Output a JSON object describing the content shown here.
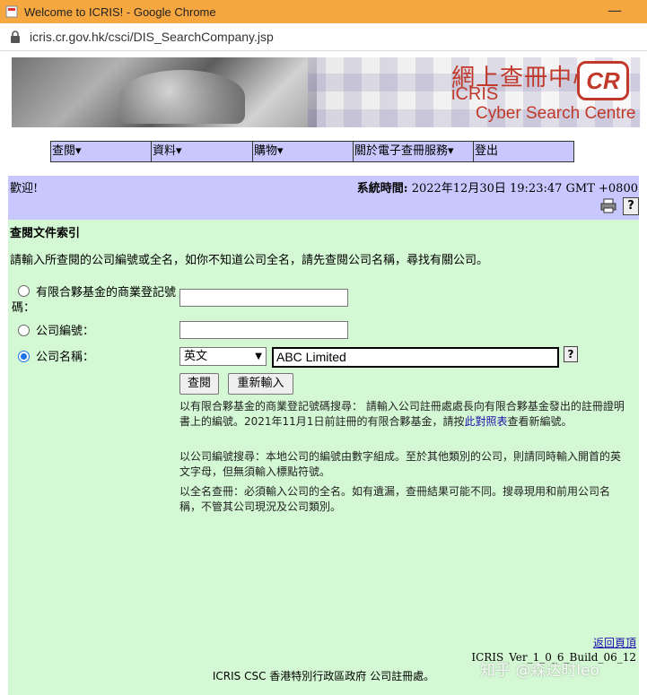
{
  "window": {
    "title": "Welcome to ICRIS! - Google Chrome",
    "minimize": "—"
  },
  "address": {
    "url": "icris.cr.gov.hk/csci/DIS_SearchCompany.jsp"
  },
  "banner": {
    "title_cjk": "網上查冊中心",
    "logo": "CR",
    "brand": "iCRIS",
    "subtitle": "Cyber Search Centre"
  },
  "menu": [
    {
      "label": "查閱▾"
    },
    {
      "label": "資料▾"
    },
    {
      "label": "購物▾"
    },
    {
      "label": "關於電子查冊服務▾"
    },
    {
      "label": "登出"
    }
  ],
  "welcome": {
    "greeting": "歡迎!",
    "time_label": "系統時間:",
    "time_value": " 2022年12月30日 19:23:47 GMT +0800",
    "help_glyph": "?"
  },
  "form": {
    "heading": "查閱文件索引",
    "instruction": "請輸入所查閱的公司編號或全名，如你不知道公司全名，請先查閱公司名稱，尋找有關公司。",
    "option_brn_label": "有限合夥基金的商業登記號碼：",
    "option_crno_label": "公司編號：",
    "option_name_label": "公司名稱：",
    "language_select": "英文",
    "company_name_value": "ABC Limited",
    "search_button": "查閱",
    "reset_button": "重新輸入",
    "help_glyph": "?",
    "note1_a": "以有限合夥基金的商業登記號碼搜尋： 請輸入公司註冊處處長向有限合夥基金發出的註冊證明書上的編號。2021年11月1日前註冊的有限合夥基金，請按",
    "note1_link": "此對照表",
    "note1_b": "查看新編號。",
    "note2": "以公司編號搜尋：本地公司的編號由數字組成。至於其他類別的公司，則請同時輸入開首的英文字母，但無須輸入標點符號。",
    "note3": "以全名查冊：必須輸入公司的全名。如有遺漏，查冊結果可能不同。搜尋現用和前用公司名稱，不管其公司現況及公司類別。"
  },
  "footer": {
    "back_link": "返回頁頂",
    "version": "ICRIS_Ver_1_0_6_Build_06_12",
    "org": "ICRIS CSC 香港特別行政區政府 公司註冊處。"
  },
  "watermark": "知乎 @森达时leo"
}
